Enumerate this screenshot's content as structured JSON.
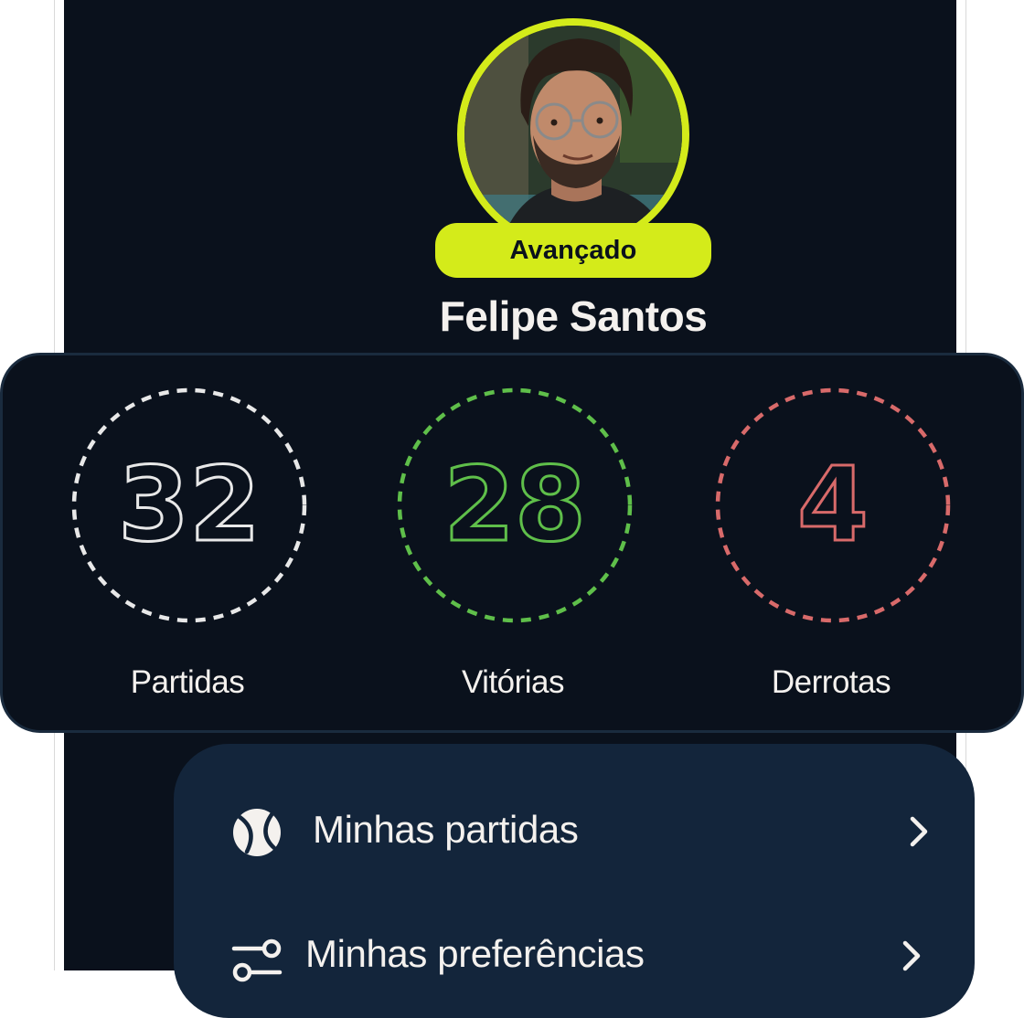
{
  "profile": {
    "name": "Felipe Santos",
    "level": "Avançado",
    "accent_color": "#d4eb1a"
  },
  "stats": [
    {
      "value": "32",
      "label": "Partidas",
      "color": "#e8e8e8"
    },
    {
      "value": "28",
      "label": "Vitórias",
      "color": "#5fbf4a"
    },
    {
      "value": "4",
      "label": "Derrotas",
      "color": "#d86a6a"
    }
  ],
  "menu": {
    "items": [
      {
        "label": "Minhas partidas",
        "icon": "tennis-ball-icon"
      },
      {
        "label": "Minhas preferências",
        "icon": "sliders-icon"
      }
    ]
  }
}
